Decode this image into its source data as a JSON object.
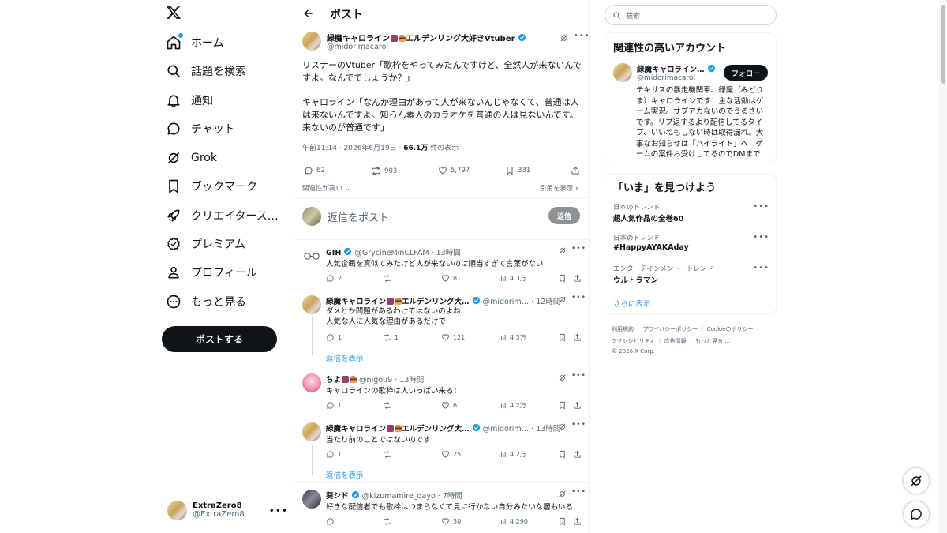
{
  "nav": {
    "items": [
      {
        "label": "ホーム",
        "icon": "home-icon"
      },
      {
        "label": "話題を検索",
        "icon": "search-icon"
      },
      {
        "label": "通知",
        "icon": "bell-icon"
      },
      {
        "label": "チャット",
        "icon": "chat-icon"
      },
      {
        "label": "Grok",
        "icon": "grok-icon"
      },
      {
        "label": "ブックマーク",
        "icon": "bookmark-icon"
      },
      {
        "label": "クリエイタース…",
        "icon": "rocket-icon"
      },
      {
        "label": "プレミアム",
        "icon": "premium-icon"
      },
      {
        "label": "プロフィール",
        "icon": "profile-icon"
      },
      {
        "label": "もっと見る",
        "icon": "more-icon"
      }
    ],
    "post_button": "ポストする",
    "account": {
      "name": "ExtraZero8",
      "handle": "@ExtraZero8"
    }
  },
  "header": {
    "title": "ポスト"
  },
  "post": {
    "author": "緑魔キャロライン",
    "author_suffix": "エルデンリング大好きVtuber",
    "handle": "@midorimacarol",
    "text_1": "リスナーのVtuber「歌枠をやってみたんですけど、全然人が来ないんですよ。なんででしょうか？」",
    "text_2": "キャロライン「なんか理由があって人が来ないんじゃなくて、普通は人は来ないんですよ。知らん素人のカラオケを普通の人は見ないんです。来ないのが普通です」",
    "time": "午前11:14 · 2026年6月19日 · ",
    "views": "66.1万",
    "views_suffix": " 件の表示",
    "replies": "62",
    "reposts": "903",
    "likes": "5,797",
    "bookmarks": "331",
    "sort_label": "関連性が高い",
    "quotes_label": "引用を表示"
  },
  "composer": {
    "placeholder": "返信をポスト",
    "button": "返信"
  },
  "replies": [
    {
      "name": "GIH",
      "handle": "@GrycineMinCLFAM",
      "time": "13時間",
      "text": "人気企画を真似てみたけど人が来ないのは順当すぎて言葉がない",
      "replies": "2",
      "reposts": "",
      "likes": "81",
      "views": "4.3万"
    },
    {
      "name": "緑魔キャロライン",
      "name_suffix": "エルデンリング大…",
      "handle": "@midorim…",
      "time": "12時間",
      "text": "ダメとか問題があるわけではないのよね\n人気な人に人気な理由があるだけで",
      "replies": "1",
      "reposts": "1",
      "likes": "121",
      "views": "4.3万",
      "show_replies": "返信を表示"
    },
    {
      "name": "ちよ",
      "handle": "@nigou9",
      "time": "13時間",
      "text": "キャロラインの歌枠は人いっぱい来る！",
      "replies": "1",
      "reposts": "",
      "likes": "6",
      "views": "4.2万"
    },
    {
      "name": "緑魔キャロライン",
      "name_suffix": "エルデンリング大…",
      "handle": "@midorim…",
      "time": "13時間",
      "text": "当たり前のことではないのです",
      "replies": "1",
      "reposts": "",
      "likes": "25",
      "views": "4.2万",
      "show_replies": "返信を表示"
    },
    {
      "name": "葵シド",
      "handle": "@kizumamire_dayo",
      "time": "7時間",
      "text": "好きな配信者でも歌枠はつまらなくて見に行かない自分みたいな層もいる",
      "replies": "",
      "reposts": "",
      "likes": "30",
      "views": "4,290"
    }
  ],
  "search": {
    "placeholder": "検索"
  },
  "related": {
    "title": "関連性の高いアカウント",
    "name": "緑魔キャロライン…",
    "handle": "@midorimacarol",
    "follow": "フォロー",
    "bio": "テキサスの暴走機関車、緑魔（みどりま）キャロラインです！主な活動はゲーム実況。サブアカないのでうるさいです。リプ返するより配信してるタイプ、いいねもしない時は取得漏れ。大事なお知らせは「ハイライト」へ！ゲームの案件お受けしてるのでDMまで"
  },
  "trends": {
    "title": "「いま」を見つけよう",
    "items": [
      {
        "category": "日本のトレンド",
        "topic": "超人気作品の全巻60"
      },
      {
        "category": "日本のトレンド",
        "topic": "#HappyAYAKAday"
      },
      {
        "category": "エンターテインメント · トレンド",
        "topic": "ウルトラマン"
      }
    ],
    "show_more": "さらに表示"
  },
  "footer": {
    "line1": "利用規約 ｜ プライバシーポリシー ｜ Cookieのポリシー ｜",
    "line2": "アクセシビリティ ｜ 広告情報 ｜ もっと見る …",
    "line3": "© 2026 X Corp."
  }
}
